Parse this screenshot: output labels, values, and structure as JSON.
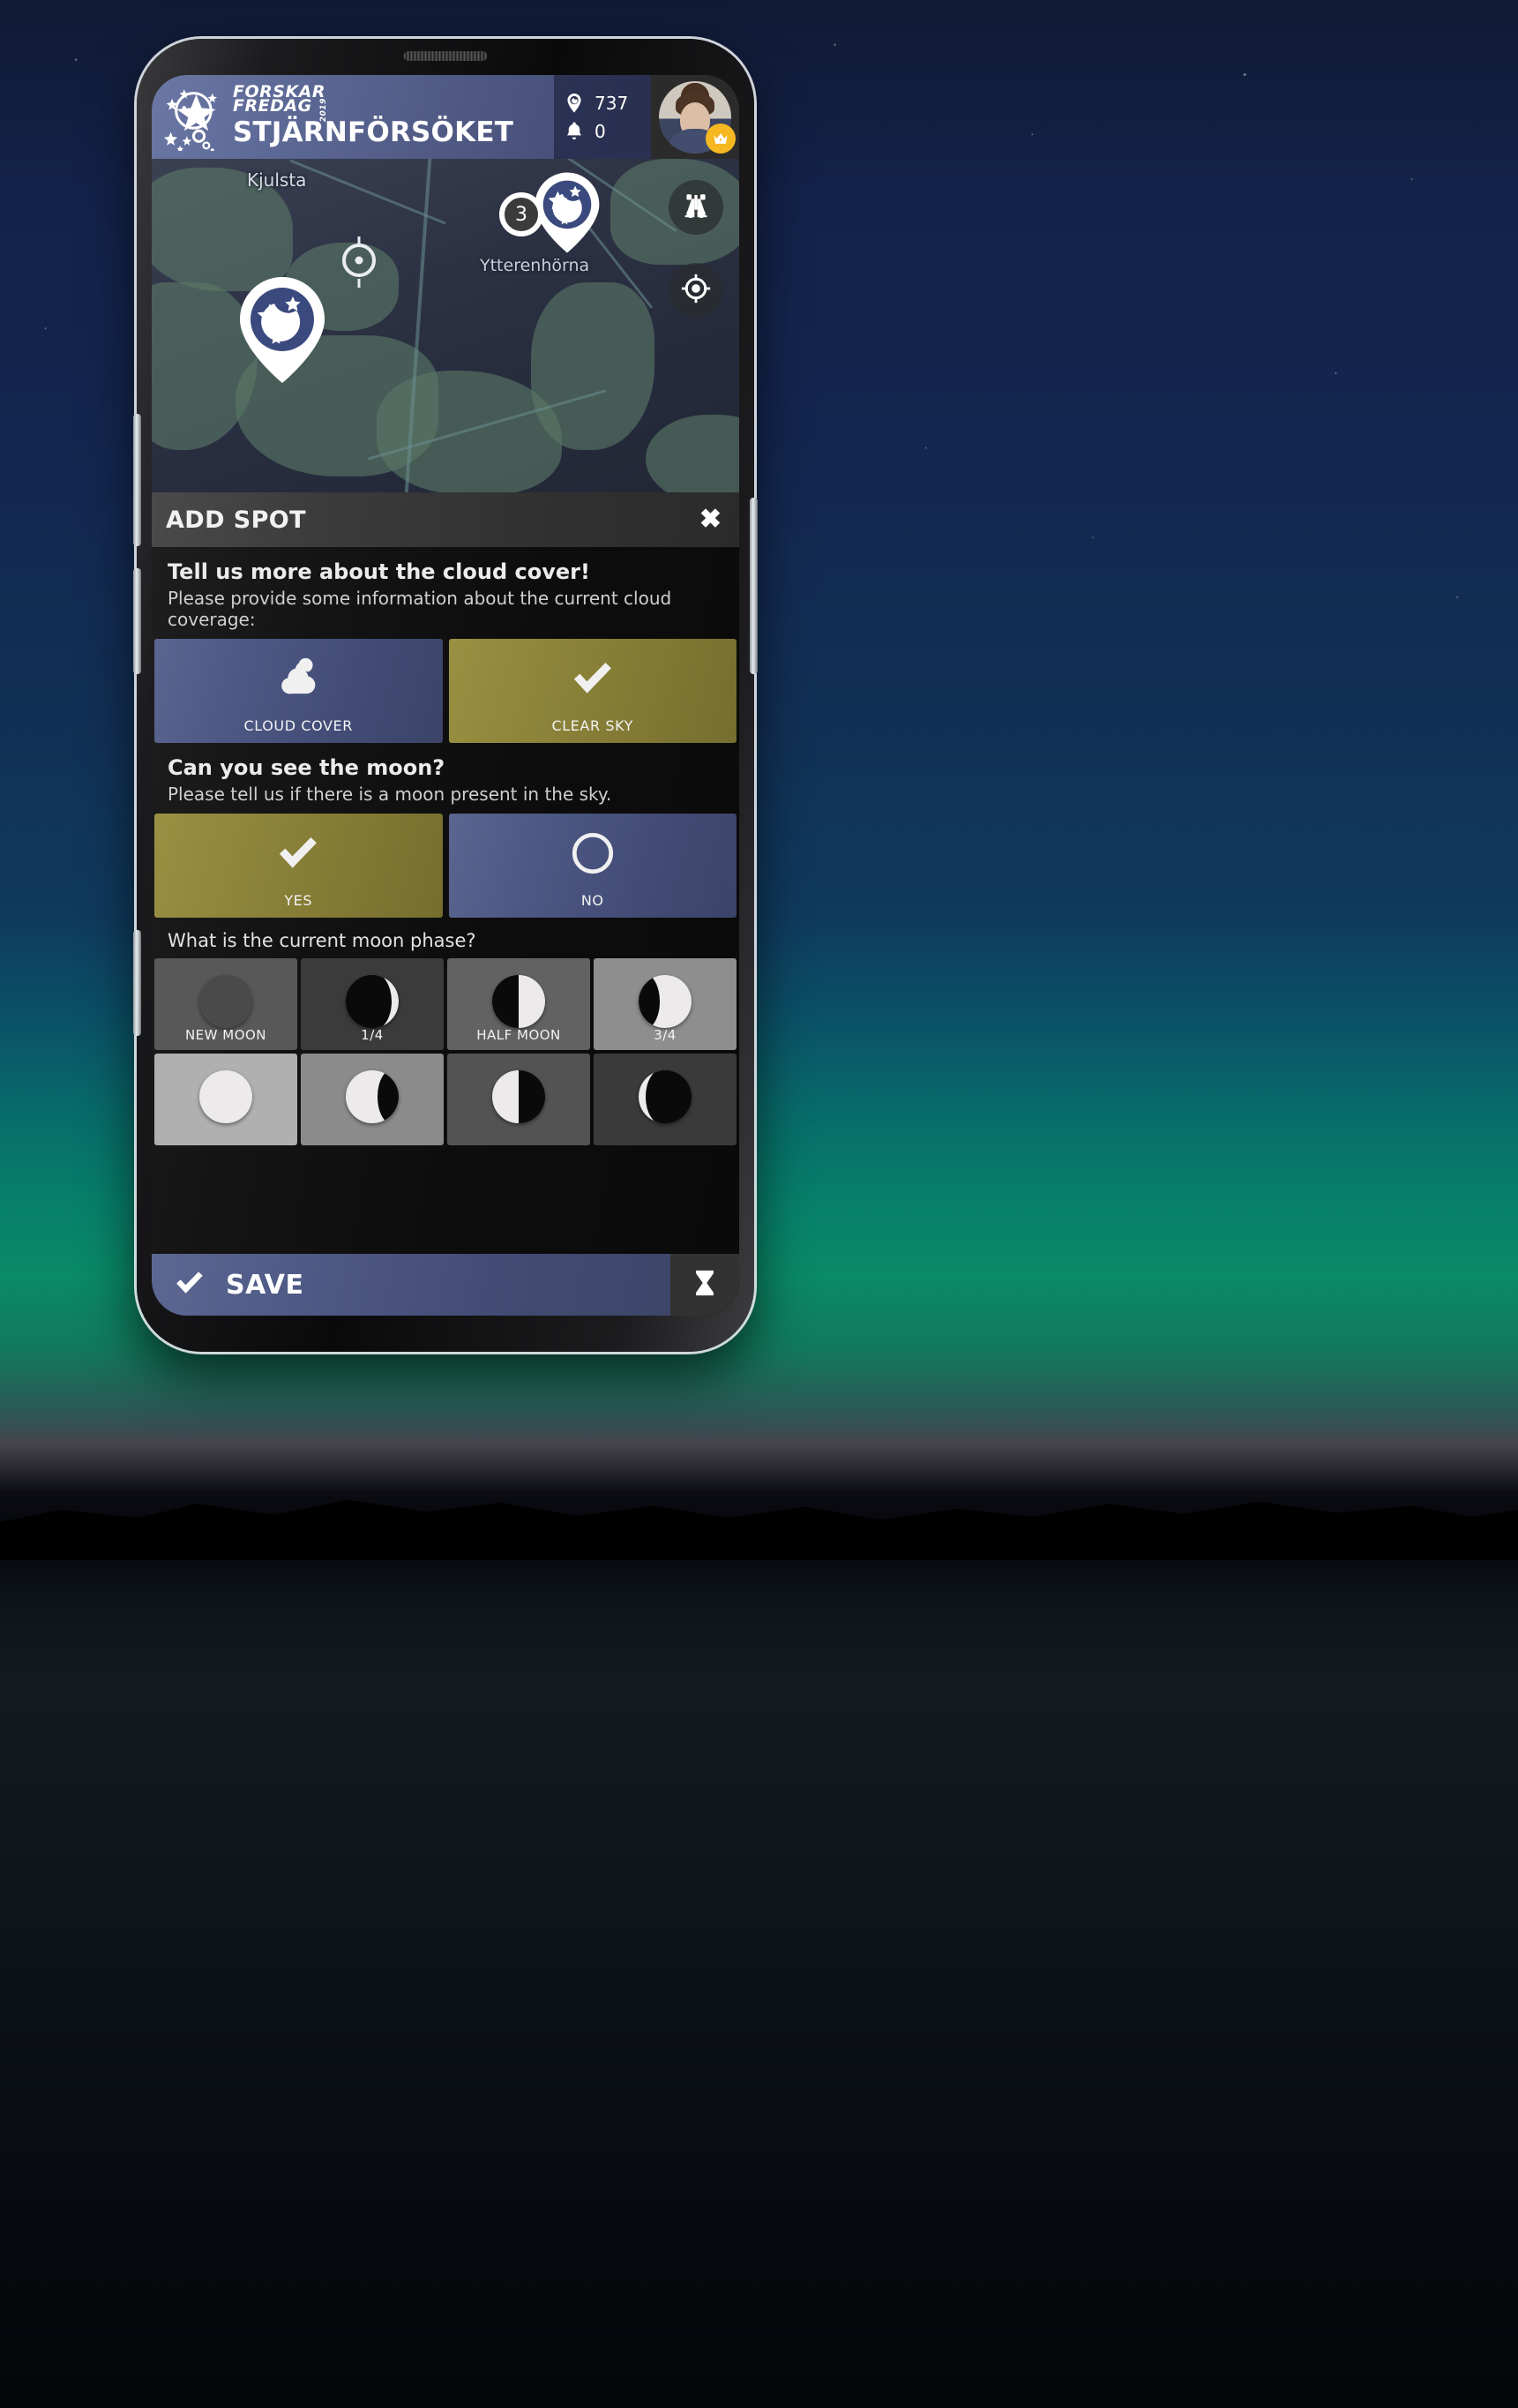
{
  "app": {
    "brand_line1": "FORSKAR",
    "brand_line2": "FREDAG",
    "brand_year": "2019",
    "title": "STJÄRNFÖRSÖKET",
    "logo_icon": "star-circle-logo-icon"
  },
  "header": {
    "spots_icon": "map-pin-moon-icon",
    "spots_count": "737",
    "notifications_icon": "bell-icon",
    "notifications_count": "0",
    "avatar_name": "user-avatar",
    "crown_badge_icon": "crown-icon"
  },
  "map": {
    "label_primary": "Kjulsta",
    "label_secondary": "Ytterenhörna",
    "cluster_count": "3",
    "pin_icon": "star-moon-pin-icon",
    "selected_marker_icon": "crosshair-target-icon",
    "buttons": [
      {
        "name": "binoculars-button",
        "icon": "binoculars-icon"
      },
      {
        "name": "locate-me-button",
        "icon": "locate-crosshair-icon"
      }
    ]
  },
  "sheet": {
    "title": "ADD SPOT",
    "close_icon": "close-x-icon",
    "cloud": {
      "heading": "Tell us more about the cloud cover!",
      "subheading": "Please provide some information about the current cloud coverage:",
      "options": [
        {
          "label": "CLOUD COVER",
          "icon": "cloud-icon",
          "selected": false,
          "state": "blue"
        },
        {
          "label": "CLEAR SKY",
          "icon": "check-icon",
          "selected": true,
          "state": "olive"
        }
      ]
    },
    "moon": {
      "heading": "Can you see the moon?",
      "subheading": "Please tell us if there is a moon present in the sky.",
      "options": [
        {
          "label": "YES",
          "icon": "check-icon",
          "selected": true,
          "state": "olive"
        },
        {
          "label": "NO",
          "icon": "circle-outline-icon",
          "selected": false,
          "state": "blue"
        }
      ]
    },
    "phase": {
      "question": "What is the current moon phase?",
      "cells": [
        {
          "label": "NEW MOON",
          "icon": "moon-new-icon",
          "bg": "#585858",
          "lit": 0.0,
          "side": "right"
        },
        {
          "label": "1/4",
          "icon": "moon-waxing-crescent-icon",
          "bg": "#3b3b3b",
          "lit": 0.25,
          "side": "right"
        },
        {
          "label": "HALF MOON",
          "icon": "moon-first-quarter-icon",
          "bg": "#626262",
          "lit": 0.5,
          "side": "right"
        },
        {
          "label": "3/4",
          "icon": "moon-waxing-gibbous-icon",
          "bg": "#8e8e8e",
          "lit": 0.75,
          "side": "right"
        },
        {
          "label": "",
          "icon": "moon-full-icon",
          "bg": "#b0b0b0",
          "lit": 1.0,
          "side": "right"
        },
        {
          "label": "",
          "icon": "moon-waning-gibbous-icon",
          "bg": "#8b8b8b",
          "lit": 0.75,
          "side": "left"
        },
        {
          "label": "",
          "icon": "moon-last-quarter-icon",
          "bg": "#535353",
          "lit": 0.5,
          "side": "left"
        },
        {
          "label": "",
          "icon": "moon-waning-crescent-icon",
          "bg": "#3a3a3a",
          "lit": 0.25,
          "side": "left"
        }
      ]
    }
  },
  "footer": {
    "save_label": "SAVE",
    "save_icon": "check-icon",
    "pending_icon": "hourglass-icon"
  },
  "colors": {
    "brand_blue": "#4d5884",
    "selected_olive": "#8b8239",
    "sheet_bg": "#0f0f0f",
    "badge_yellow": "#f6b821"
  }
}
